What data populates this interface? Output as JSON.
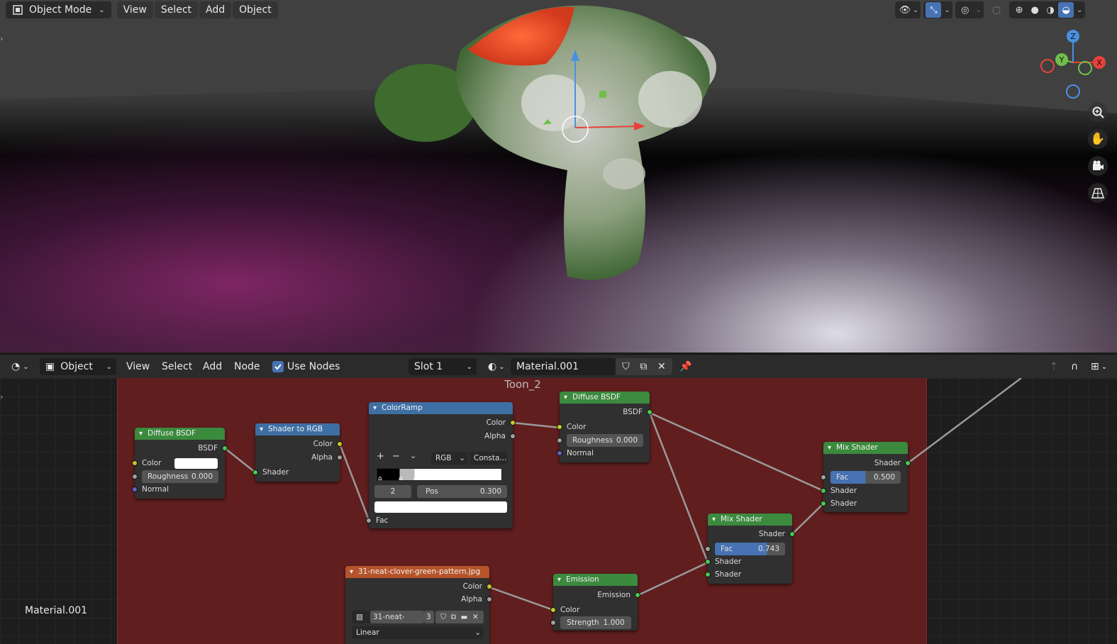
{
  "viewport": {
    "mode_label": "Object Mode",
    "menu": [
      "View",
      "Select",
      "Add",
      "Object"
    ],
    "gizmo_axes": {
      "z": "Z",
      "y": "Y",
      "x": "X"
    }
  },
  "node_editor": {
    "editor_type": "Object",
    "menu": [
      "View",
      "Select",
      "Add",
      "Node"
    ],
    "use_nodes_label": "Use Nodes",
    "slot": "Slot 1",
    "material_name": "Material.001",
    "frame_label": "Toon_2",
    "corner_material_label": "Material.001"
  },
  "nodes": {
    "diffuse1": {
      "title": "Diffuse BSDF",
      "out": "BSDF",
      "color": "Color",
      "roughness_label": "Roughness",
      "roughness": "0.000",
      "normal": "Normal"
    },
    "shader_to_rgb": {
      "title": "Shader to RGB",
      "color": "Color",
      "alpha": "Alpha",
      "shader": "Shader"
    },
    "colorramp": {
      "title": "ColorRamp",
      "color": "Color",
      "alpha": "Alpha",
      "plus": "+",
      "minus": "−",
      "mode": "RGB",
      "interp": "Consta...",
      "index": "2",
      "pos_label": "Pos",
      "pos": "0.300",
      "fac": "Fac"
    },
    "diffuse2": {
      "title": "Diffuse BSDF",
      "out": "BSDF",
      "color": "Color",
      "roughness_label": "Roughness",
      "roughness": "0.000",
      "normal": "Normal"
    },
    "mix1": {
      "title": "Mix Shader",
      "out": "Shader",
      "fac_label": "Fac",
      "fac": "0.500",
      "fac_value": 0.5,
      "in1": "Shader",
      "in2": "Shader"
    },
    "mix2": {
      "title": "Mix Shader",
      "out": "Shader",
      "fac_label": "Fac",
      "fac": "0.743",
      "fac_value": 0.743,
      "in1": "Shader",
      "in2": "Shader"
    },
    "image": {
      "title": "31-neat-clover-green-pattern.jpg",
      "color": "Color",
      "alpha": "Alpha",
      "image_name": "31-neat-clov...",
      "users": "3",
      "interp": "Linear"
    },
    "emission": {
      "title": "Emission",
      "out": "Emission",
      "color": "Color",
      "strength_label": "Strength",
      "strength": "1.000"
    }
  },
  "colors": {
    "accent": "#4772b3",
    "frame": "#611e1e",
    "shader_header": "#3b8a3e",
    "converter_header": "#3e6fa3",
    "texture_header": "#b5532a"
  }
}
